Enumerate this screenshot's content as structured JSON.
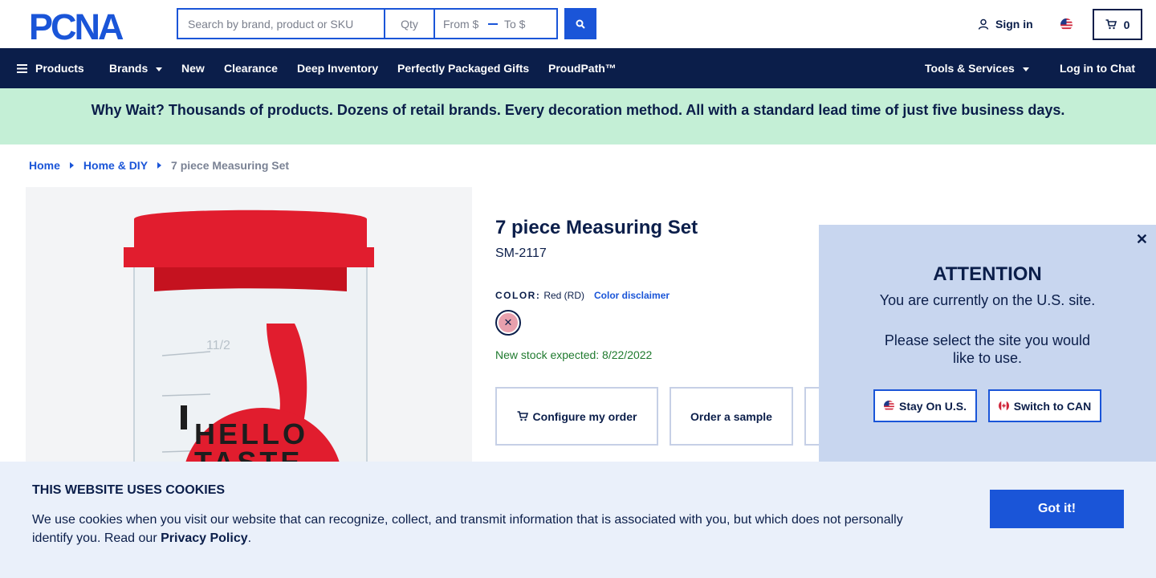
{
  "header": {
    "logo_text": "PCNA",
    "search": {
      "placeholder": "Search by brand, product or SKU",
      "qty_placeholder": "Qty",
      "from_label": "From $",
      "to_label": "To $"
    },
    "sign_in": "Sign in",
    "cart_count": "0"
  },
  "nav": {
    "products": "Products",
    "brands": "Brands",
    "new": "New",
    "clearance": "Clearance",
    "deep_inventory": "Deep Inventory",
    "gifts": "Perfectly Packaged Gifts",
    "proudpath": "ProudPath™",
    "tools": "Tools & Services",
    "chat": "Log in to Chat"
  },
  "promo": "Why Wait? Thousands of products. Dozens of retail brands. Every decoration method. All with a standard lead time of just five business days.",
  "breadcrumb": {
    "home": "Home",
    "category": "Home & DIY",
    "current": "7 piece Measuring Set"
  },
  "product": {
    "title": "7 piece Measuring Set",
    "sku": "SM-2117",
    "color_label": "COLOR:",
    "color_value": "Red (RD)",
    "color_disclaimer": "Color disclaimer",
    "stock": "New stock expected: 8/22/2022",
    "configure": "Configure my order",
    "sample": "Order a sample",
    "image_text_1": "HELLO",
    "image_text_2": "TASTE",
    "image_mark": "11/2"
  },
  "attention": {
    "title": "ATTENTION",
    "msg1": "You are currently on the U.S. site.",
    "msg2": "Please select the site you would like to use.",
    "stay": "Stay On U.S.",
    "switch": "Switch to CAN"
  },
  "cookie": {
    "title": "THIS WEBSITE USES COOKIES",
    "text": "We use cookies when you visit our website that can recognize, collect, and transmit information that is associated with you, but which does not personally identify you. Read our ",
    "link": "Privacy Policy",
    "end": ".",
    "button": "Got it!"
  },
  "colors": {
    "navy": "#0b1e4a",
    "accent": "#1a55d8",
    "promo_bg": "#c4efd6",
    "product_red": "#e11d2e"
  }
}
